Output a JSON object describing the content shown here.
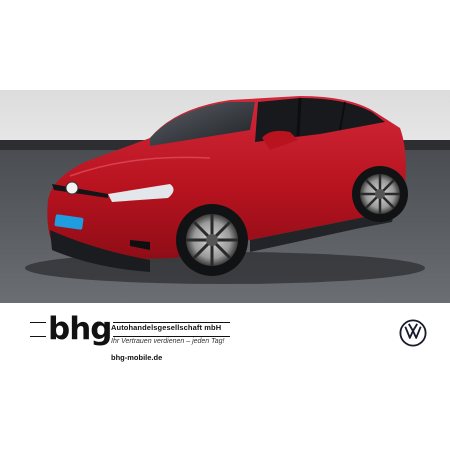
{
  "dealer": {
    "logo_text": "bhg",
    "company_name": "Autohandelsgesellschaft mbH",
    "slogan": "Ihr Vertrauen verdienen – jeden Tag!",
    "website": "bhg-mobile.de"
  },
  "brand": {
    "logo_icon": "vw-logo-icon",
    "color": "#1a1a2e"
  },
  "vehicle": {
    "color": "#c0142a"
  }
}
